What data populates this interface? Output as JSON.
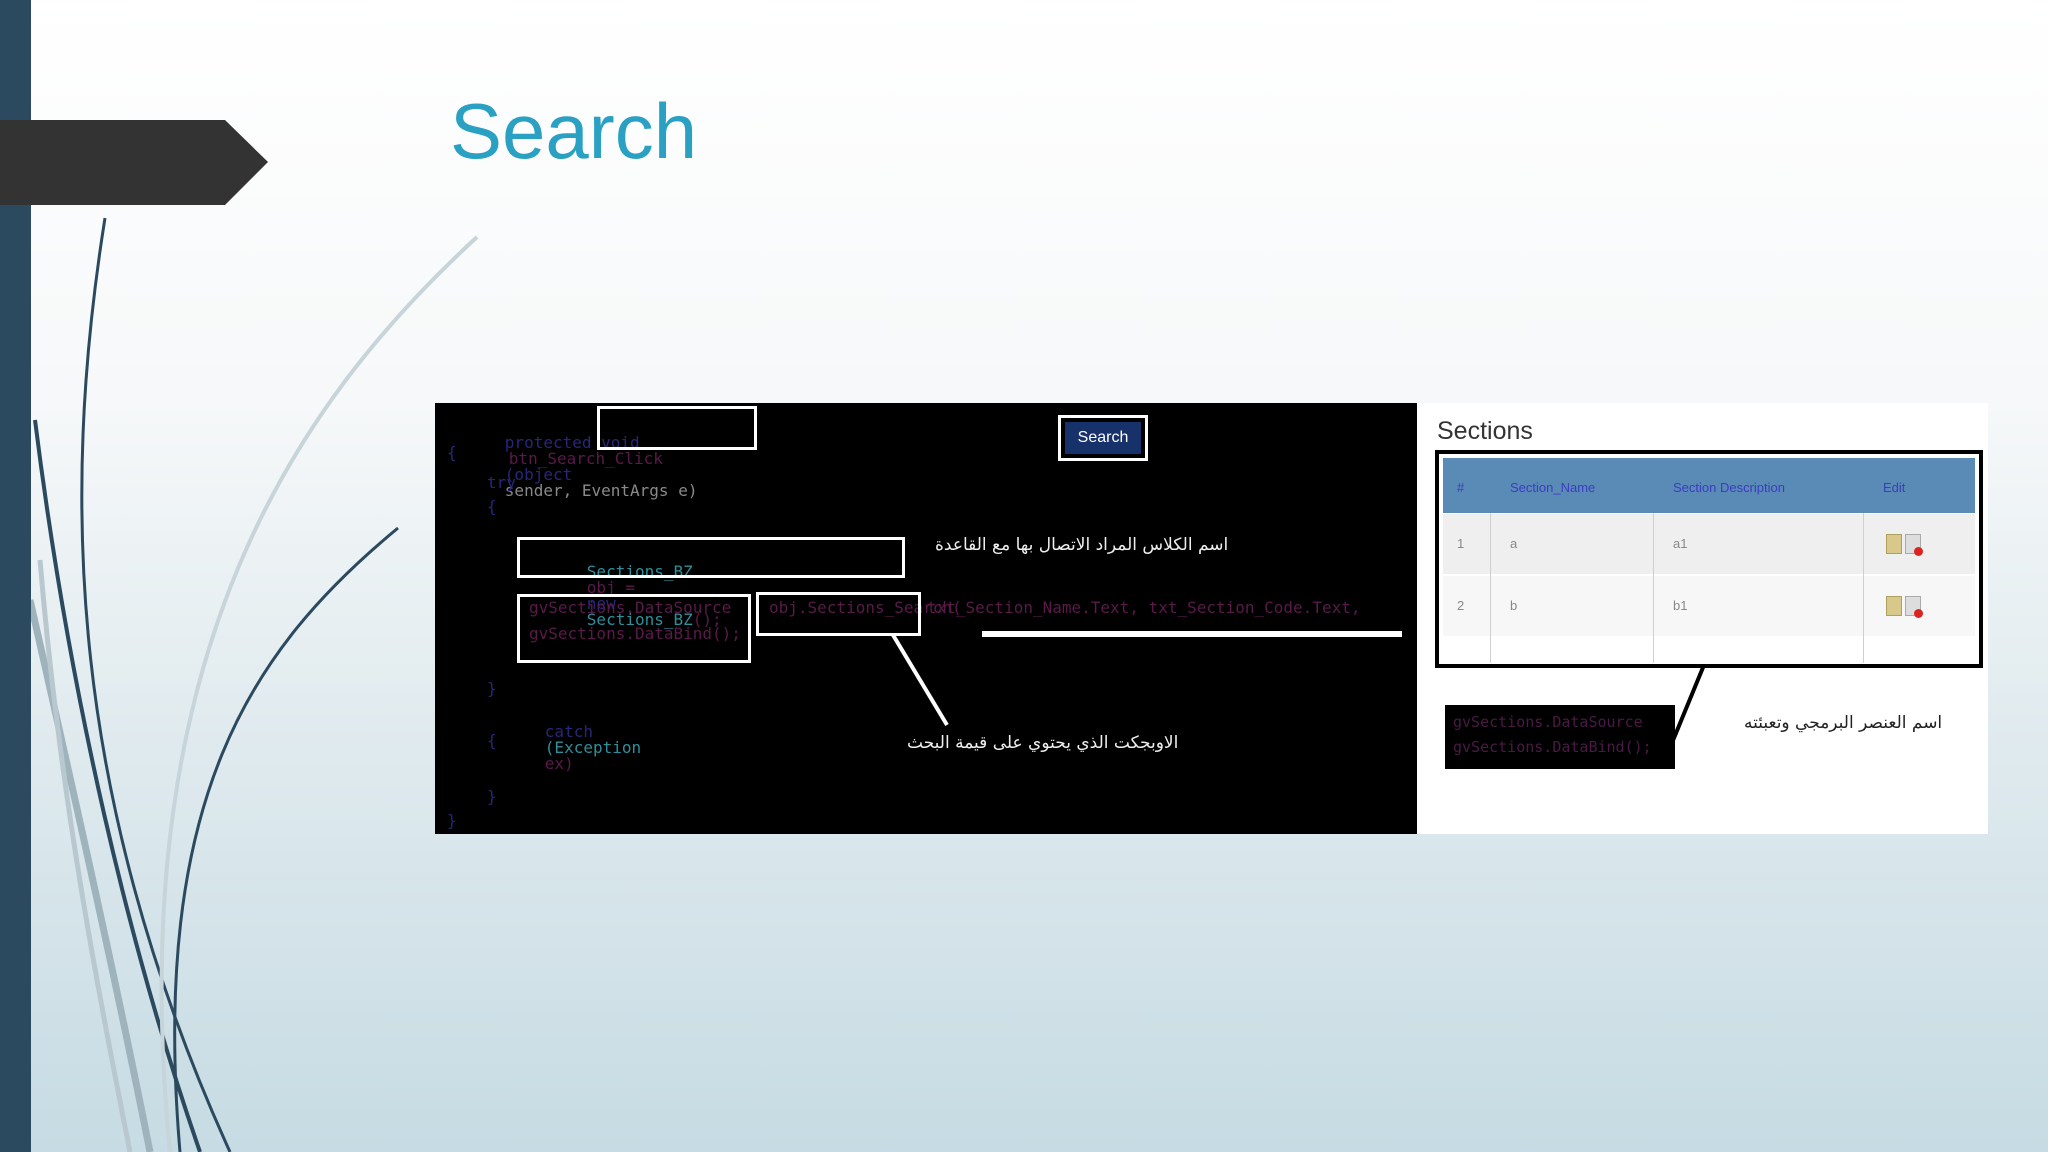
{
  "slide": {
    "title": "Search",
    "colors": {
      "title": "#2aa0c3",
      "left_bar": "#2b4a5f",
      "arrow": "#333333"
    }
  },
  "code": {
    "line1_keyword": "protected void",
    "line1_method": "btn_Search_Click",
    "line1_type": "(object",
    "line1_args": "sender, EventArgs e)",
    "brace_open": "{",
    "try": "try",
    "try_open": "{",
    "new_obj_class": "Sections_BZ",
    "new_obj_var": "obj =",
    "new_obj_new": "new",
    "new_obj_ctor": "Sections_BZ",
    "new_obj_end": "();",
    "datasource": "gvSections.DataSource",
    "databind": "gvSections.DataBind();",
    "search_call": "obj.Sections_Search(",
    "search_args": "txt_Section_Name.Text, txt_Section_Code.Text,",
    "try_close": "}",
    "catch_kw": "catch",
    "catch_type": "(Exception",
    "catch_var": "ex)",
    "catch_open": "{",
    "catch_close": "}",
    "brace_close": "}"
  },
  "search_button_label": "Search",
  "notes": {
    "class_note": "اسم الكلاس المراد الاتصال بها مع القاعدة",
    "object_note": "الاوبجكت الذي يحتوي على قيمة البحث",
    "grid_note": "اسم العنصر البرمجي وتعبئته"
  },
  "sections": {
    "title": "Sections",
    "headers": [
      "#",
      "Section_Name",
      "Section Description",
      "Edit"
    ],
    "rows": [
      {
        "num": "1",
        "name": "a",
        "description": "a1"
      },
      {
        "num": "2",
        "name": "b",
        "description": "b1"
      }
    ],
    "datasource": "gvSections.DataSource",
    "databind": "gvSections.DataBind();"
  }
}
